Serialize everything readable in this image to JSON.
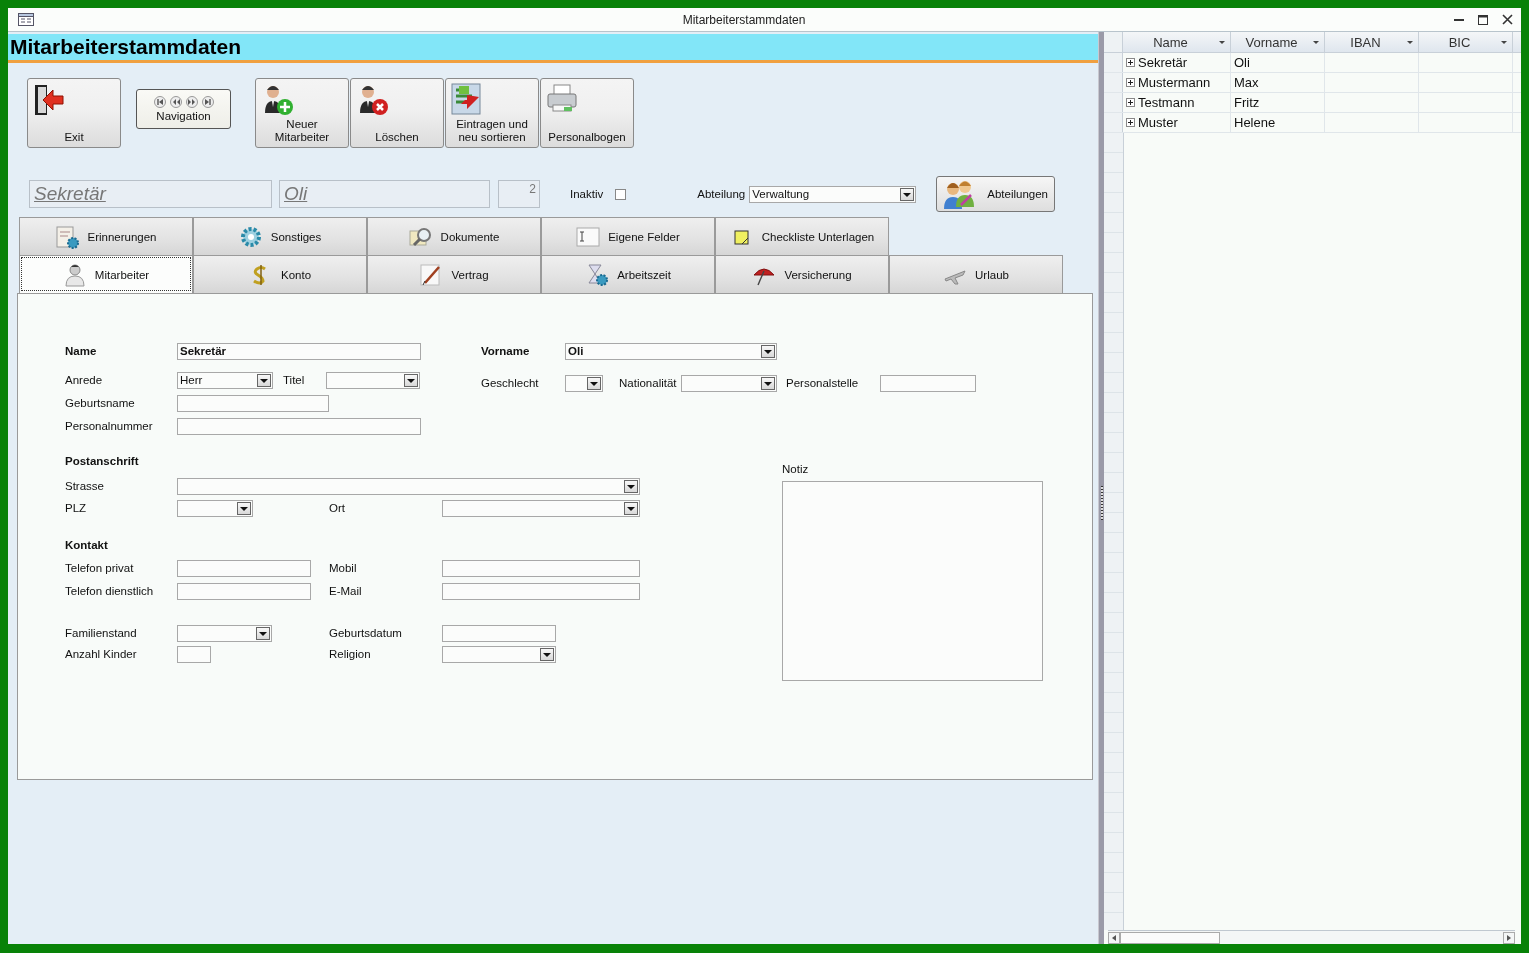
{
  "window": {
    "title": "Mitarbeiterstammdaten"
  },
  "header": {
    "title": "Mitarbeiterstammdaten"
  },
  "toolbar": [
    {
      "kind": "button",
      "label": "Exit"
    },
    {
      "kind": "navigation",
      "label": "Navigation"
    },
    {
      "kind": "button",
      "label": "Neuer Mitarbeiter"
    },
    {
      "kind": "button",
      "label": "Löschen"
    },
    {
      "kind": "button",
      "label": "Eintragen und neu sortieren"
    },
    {
      "kind": "button",
      "label": "Personalbogen"
    }
  ],
  "record": {
    "name": "Sekretär",
    "first_name": "Oli",
    "number": "2",
    "inactive": {
      "label": "Inaktiv",
      "checked": false
    },
    "department": {
      "label": "Abteilung",
      "value": "Verwaltung"
    },
    "department_button": "Abteilungen"
  },
  "tabs": {
    "rows": [
      [
        {
          "label": "Erinnerungen",
          "selected": false
        },
        {
          "label": "Sonstiges",
          "selected": false
        },
        {
          "label": "Dokumente",
          "selected": false
        },
        {
          "label": "Eigene Felder",
          "selected": false
        },
        {
          "label": "Checkliste Unterlagen",
          "selected": false
        }
      ],
      [
        {
          "label": "Mitarbeiter",
          "selected": true
        },
        {
          "label": "Konto",
          "selected": false
        },
        {
          "label": "Vertrag",
          "selected": false
        },
        {
          "label": "Arbeitszeit",
          "selected": false
        },
        {
          "label": "Versicherung",
          "selected": false
        },
        {
          "label": "Urlaub",
          "selected": false
        }
      ]
    ]
  },
  "form": {
    "fields": [
      {
        "kind": "text",
        "label": "Name",
        "value": "Sekretär",
        "bold": true
      },
      {
        "kind": "combo",
        "label": "Vorname",
        "value": "Oli",
        "bold": true
      },
      {
        "kind": "combo",
        "label": "Anrede",
        "value": "Herr"
      },
      {
        "kind": "combo",
        "label": "Titel"
      },
      {
        "kind": "combo",
        "label": "Geschlecht"
      },
      {
        "kind": "combo",
        "label": "Nationalität"
      },
      {
        "kind": "text",
        "label": "Personalstelle"
      },
      {
        "kind": "text",
        "label": "Geburtsname"
      },
      {
        "kind": "text",
        "label": "Personalnummer"
      },
      {
        "kind": "heading",
        "label": "Postanschrift"
      },
      {
        "kind": "combo",
        "label": "Strasse"
      },
      {
        "kind": "combo",
        "label": "PLZ"
      },
      {
        "kind": "combo",
        "label": "Ort"
      },
      {
        "kind": "memo",
        "label": "Notiz"
      },
      {
        "kind": "heading",
        "label": "Kontakt"
      },
      {
        "kind": "text",
        "label": "Telefon privat"
      },
      {
        "kind": "text",
        "label": "Mobil"
      },
      {
        "kind": "text",
        "label": "Telefon dienstlich"
      },
      {
        "kind": "text",
        "label": "E-Mail"
      },
      {
        "kind": "combo",
        "label": "Familienstand"
      },
      {
        "kind": "text",
        "label": "Geburtsdatum"
      },
      {
        "kind": "text",
        "label": "Anzahl Kinder"
      },
      {
        "kind": "combo",
        "label": "Religion"
      }
    ]
  },
  "datasheet": {
    "columns": [
      "Name",
      "Vorname",
      "IBAN",
      "BIC"
    ],
    "rows": [
      {
        "expanded": false,
        "cells": [
          "Sekretär",
          "Oli"
        ]
      },
      {
        "expanded": false,
        "cells": [
          "Mustermann",
          "Max"
        ]
      },
      {
        "expanded": false,
        "cells": [
          "Testmann",
          "Fritz"
        ]
      },
      {
        "expanded": false,
        "cells": [
          "Muster",
          "Helene"
        ]
      }
    ]
  }
}
